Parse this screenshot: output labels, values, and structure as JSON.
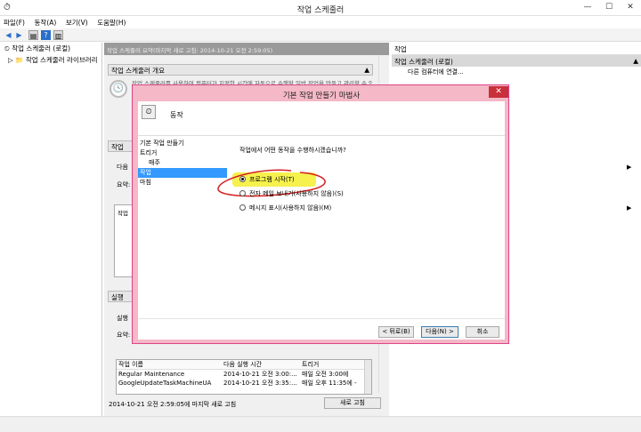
{
  "window": {
    "title": "작업 스케줄러"
  },
  "menu": [
    "파일(F)",
    "동작(A)",
    "보기(V)",
    "도움말(H)"
  ],
  "tree": {
    "root": "작업 스케줄러 (로컬)",
    "child": "작업 스케줄러 라이브러리"
  },
  "center": {
    "header": "작업 스케줄러 요약(마지막 새로 고침: 2014-10-21 오전 2:59:05)",
    "overview_title": "작업 스케줄러 개요",
    "overview_text": "작업 스케줄러를 사용하여 컴퓨터가 지정한 시간에 자동으로 수행할 일반 작업을 만들고 관리할 수 있습니다. 시작하려면 동작 메뉴...",
    "status_title": "작업 상태",
    "status_line1": "다음",
    "status_line2": "요약:",
    "active_title": "실행 중",
    "active_line1": "실행",
    "active_line2": "요약:",
    "table_headers": [
      "작업 이름",
      "다음 실행 시간",
      "트리거"
    ],
    "table_rows": [
      [
        "Regular Maintenance",
        "2014-10-21 오전 3:00:...",
        "매일 오전 3:00에"
      ],
      [
        "GoogleUpdateTaskMachineUA",
        "2014-10-21 오전 3:35:...",
        "매일 오후 11:35에 -"
      ]
    ]
  },
  "statusbar": {
    "text": "2014-10-21 오전 2:59:05에 마지막 새로 고침",
    "refresh": "새로 고침"
  },
  "actions": {
    "header": "작업",
    "selected": "작업 스케줄러 (로컬)",
    "items": [
      "다른 컴퓨터에 연결..."
    ]
  },
  "dialog": {
    "title": "기본 작업 만들기 마법사",
    "heading": "동작",
    "steps": [
      "기본 작업 만들기",
      "트리거",
      "매주",
      "작업",
      "마침"
    ],
    "question": "작업에서 어떤 동작을 수행하시겠습니까?",
    "options": [
      "프로그램 시작(T)",
      "전자 메일 보내기(사용하지 않음)(S)",
      "메시지 표시(사용하지 않음)(M)"
    ],
    "selected_option": 0,
    "buttons": {
      "back": "< 뒤로(B)",
      "next": "다음(N) >",
      "cancel": "취소"
    }
  }
}
